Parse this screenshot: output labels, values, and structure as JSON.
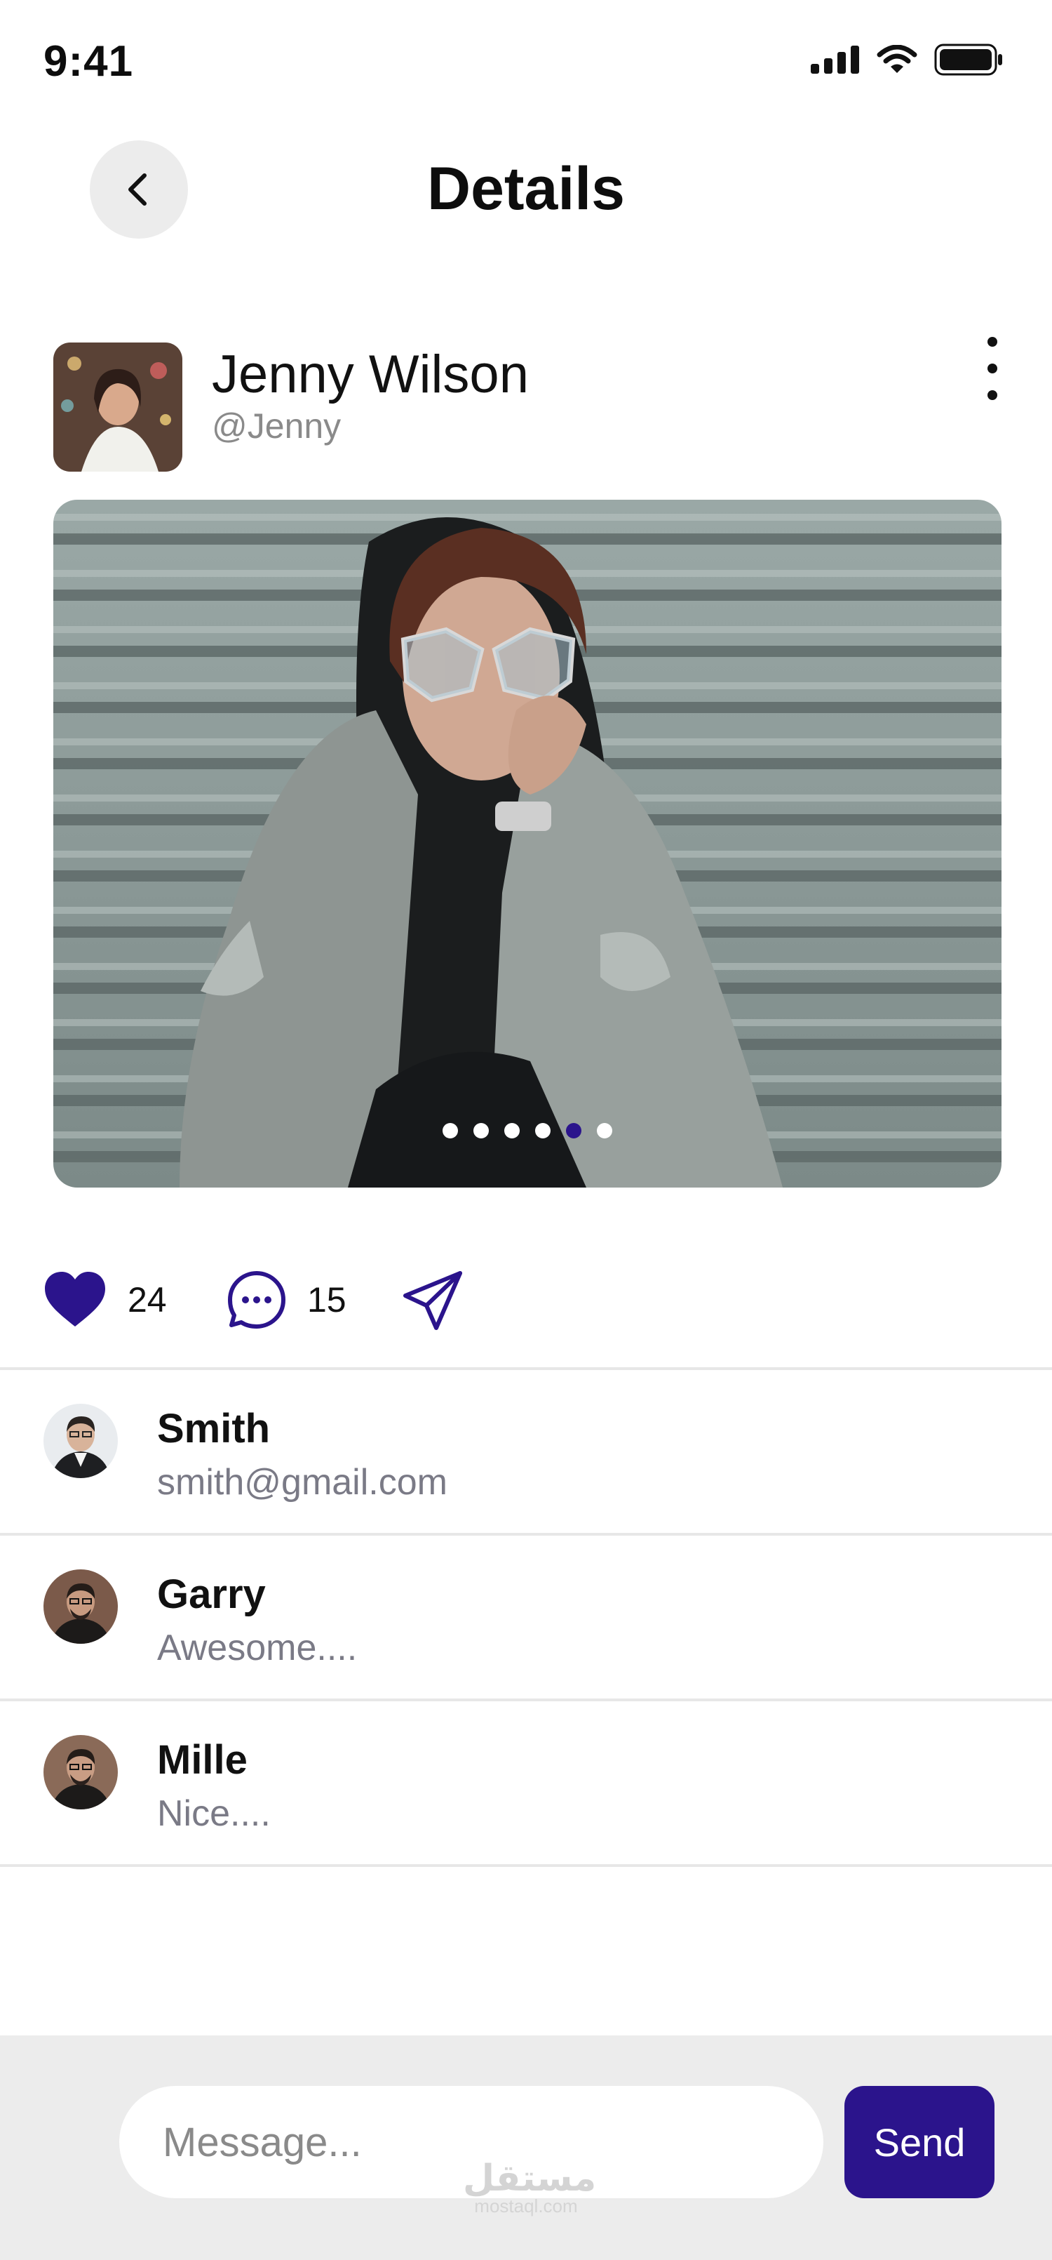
{
  "status_bar": {
    "time": "9:41"
  },
  "header": {
    "title": "Details"
  },
  "post": {
    "author_name": "Jenny Wilson",
    "author_handle": "@Jenny",
    "carousel": {
      "total": 6,
      "active_index": 4
    },
    "likes": "24",
    "comments": "15"
  },
  "comments": [
    {
      "name": "Smith",
      "text": "smith@gmail.com"
    },
    {
      "name": "Garry",
      "text": "Awesome...."
    },
    {
      "name": "Mille",
      "text": "Nice...."
    }
  ],
  "composer": {
    "placeholder": "Message...",
    "send_label": "Send"
  },
  "watermark": {
    "main": "مستقل",
    "sub": "mostaql.com"
  },
  "colors": {
    "accent": "#2b148c",
    "composer_bg": "#ececec",
    "muted_text": "#7a7a86"
  },
  "icons": [
    "signal-icon",
    "wifi-icon",
    "battery-icon",
    "back-arrow-icon",
    "more-vertical-icon",
    "heart-icon",
    "comment-icon",
    "send-plane-icon"
  ]
}
